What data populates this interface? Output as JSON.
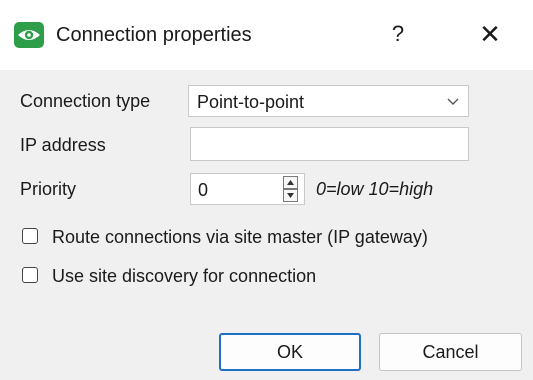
{
  "window": {
    "title": "Connection properties",
    "help_label": "?",
    "close_label": "✕",
    "icon": "eye-icon",
    "accent_color": "#2e9e4a"
  },
  "form": {
    "connection_type": {
      "label": "Connection type",
      "value": "Point-to-point"
    },
    "ip_address": {
      "label": "IP address",
      "value": ""
    },
    "priority": {
      "label": "Priority",
      "value": "0",
      "hint": "0=low 10=high"
    },
    "checkboxes": [
      {
        "label": "Route connections via site master (IP gateway)",
        "checked": false
      },
      {
        "label": "Use site discovery for connection",
        "checked": false
      }
    ]
  },
  "buttons": {
    "ok_label": "OK",
    "cancel_label": "Cancel",
    "default_border_color": "#1f6fc7"
  }
}
